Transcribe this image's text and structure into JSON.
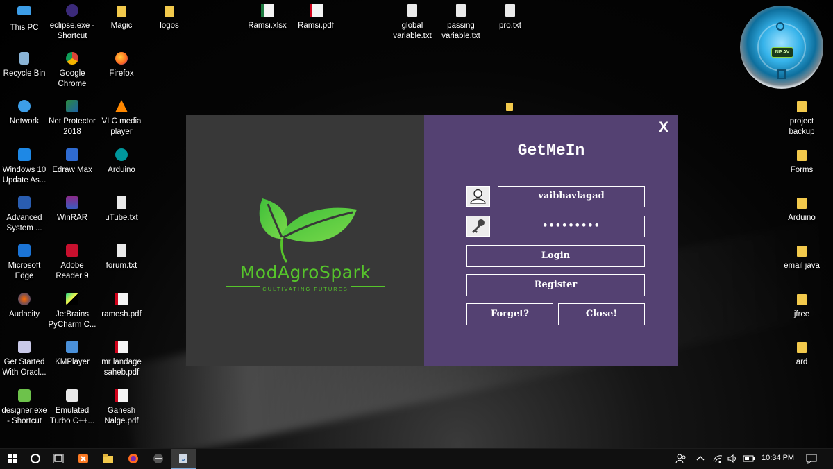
{
  "desktop": {
    "icons": [
      {
        "label": "This PC",
        "icon": "computer-icon"
      },
      {
        "label": "eclipse.exe - Shortcut",
        "icon": "eclipse-icon"
      },
      {
        "label": "Magic",
        "icon": "folder-icon"
      },
      {
        "label": "logos",
        "icon": "folder-icon"
      },
      {
        "label": "Ramsi.xlsx",
        "icon": "excel-file-icon"
      },
      {
        "label": "Ramsi.pdf",
        "icon": "pdf-file-icon"
      },
      {
        "label": "global variable.txt",
        "icon": "text-file-icon"
      },
      {
        "label": "passing variable.txt",
        "icon": "text-file-icon"
      },
      {
        "label": "pro.txt",
        "icon": "text-file-icon"
      },
      {
        "label": "Recycle Bin",
        "icon": "recycle-bin-icon"
      },
      {
        "label": "Google Chrome",
        "icon": "chrome-icon"
      },
      {
        "label": "Firefox",
        "icon": "firefox-icon"
      },
      {
        "label": "Network",
        "icon": "network-icon"
      },
      {
        "label": "Net Protector 2018",
        "icon": "net-protector-icon"
      },
      {
        "label": "VLC media player",
        "icon": "vlc-icon"
      },
      {
        "label": "Windows 10 Update As...",
        "icon": "windows-update-icon"
      },
      {
        "label": "Edraw Max",
        "icon": "edraw-icon"
      },
      {
        "label": "Arduino",
        "icon": "arduino-icon"
      },
      {
        "label": "Advanced System ...",
        "icon": "advanced-system-icon"
      },
      {
        "label": "WinRAR",
        "icon": "winrar-icon"
      },
      {
        "label": "uTube.txt",
        "icon": "text-file-icon"
      },
      {
        "label": "Microsoft Edge",
        "icon": "edge-icon"
      },
      {
        "label": "Adobe Reader 9",
        "icon": "adobe-reader-icon"
      },
      {
        "label": "forum.txt",
        "icon": "text-file-icon"
      },
      {
        "label": "Audacity",
        "icon": "audacity-icon"
      },
      {
        "label": "JetBrains PyCharm C...",
        "icon": "pycharm-icon"
      },
      {
        "label": "ramesh.pdf",
        "icon": "pdf-file-icon"
      },
      {
        "label": "Get Started With Oracl...",
        "icon": "oracle-icon"
      },
      {
        "label": "KMPlayer",
        "icon": "kmplayer-icon"
      },
      {
        "label": "mr landage saheb.pdf",
        "icon": "pdf-file-icon"
      },
      {
        "label": "designer.exe - Shortcut",
        "icon": "designer-icon"
      },
      {
        "label": "Emulated Turbo C++...",
        "icon": "turbo-cpp-icon"
      },
      {
        "label": "Ganesh Nalge.pdf",
        "icon": "pdf-file-icon"
      },
      {
        "label": "project backup",
        "icon": "folder-icon"
      },
      {
        "label": "Forms",
        "icon": "folder-icon"
      },
      {
        "label": "Arduino",
        "icon": "folder-icon"
      },
      {
        "label": "email java",
        "icon": "folder-icon"
      },
      {
        "label": "jfree",
        "icon": "folder-icon"
      },
      {
        "label": "ard",
        "icon": "folder-icon"
      }
    ]
  },
  "gadget": {
    "badge": "NP AV"
  },
  "dialog": {
    "close_label": "X",
    "title": "GetMeIn",
    "username": {
      "value": "vaibhavlagad",
      "icon": "user-icon"
    },
    "password": {
      "value": "•••••••••",
      "icon": "key-icon"
    },
    "login_label": "Login",
    "register_label": "Register",
    "forget_label": "Forget?",
    "close_button_label": "Close!",
    "logo": {
      "name": "ModAgroSpark",
      "tagline": "CULTIVATING FUTURES",
      "color": "#56c52b"
    },
    "colors": {
      "left_pane": "#383838",
      "right_pane": "#544172"
    }
  },
  "taskbar": {
    "clock": "10:34 PM",
    "items": [
      "windows-start-icon",
      "cortana-icon",
      "task-view-icon",
      "xampp-icon",
      "file-explorer-icon",
      "firefox-icon",
      "media-app-icon",
      "java-app-icon"
    ]
  }
}
